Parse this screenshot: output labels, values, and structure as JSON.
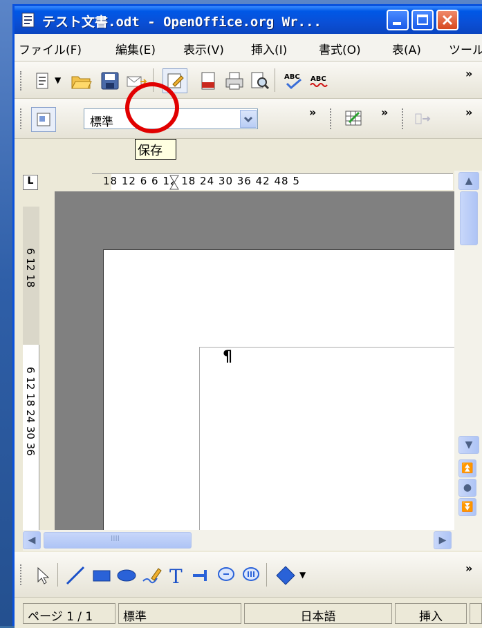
{
  "window": {
    "title": "テスト文書.odt - OpenOffice.org Wr..."
  },
  "menubar": {
    "items": [
      {
        "label": "ファイル(F)"
      },
      {
        "label": "編集(E)"
      },
      {
        "label": "表示(V)"
      },
      {
        "label": "挿入(I)"
      },
      {
        "label": "書式(O)"
      },
      {
        "label": "表(A)"
      },
      {
        "label": "ツール"
      }
    ]
  },
  "toolbar": {
    "more": "»",
    "icons": [
      "new-document-icon",
      "open-folder-icon",
      "save-icon",
      "email-icon",
      "edit-file-icon",
      "export-pdf-icon",
      "print-icon",
      "page-preview-icon",
      "spellcheck-icon",
      "autospellcheck-icon"
    ]
  },
  "format_toolbar": {
    "style": "標準",
    "more": "»"
  },
  "tooltip": {
    "text": "保存"
  },
  "ruler": {
    "corner": "L",
    "horizontal": "18  12   6        6   12  18  24  30  36  42  48  5",
    "vertical_upper": "6  12  18",
    "vertical_lower": "6  12  18  24  30  36"
  },
  "document": {
    "pilcrow": "¶"
  },
  "hscroll": {
    "grip": "IIII"
  },
  "statusbar": {
    "page": "ページ 1 / 1",
    "style": "標準",
    "language": "日本語",
    "mode": "挿入"
  },
  "colors": {
    "titlebar": "#0a4fd6",
    "highlight": "#e10000",
    "window_bg": "#ece9d8"
  }
}
